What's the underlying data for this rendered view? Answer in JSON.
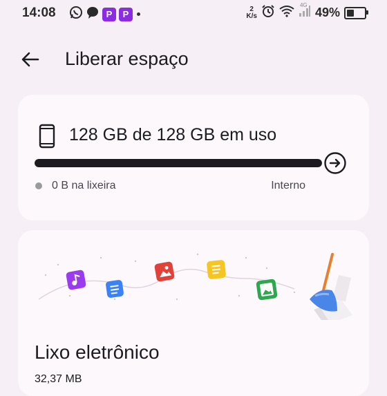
{
  "status_bar": {
    "time": "14:08",
    "app_badge_letter": "P",
    "net_speed_value": "2",
    "net_speed_unit": "K/s",
    "network_type": "4G",
    "battery_percent": "49%",
    "battery_level": 0.49
  },
  "header": {
    "title": "Liberar espaço"
  },
  "storage_card": {
    "usage_text": "128 GB de 128 GB em uso",
    "usage_fraction": 1.0,
    "trash_text": "0 B na lixeira",
    "location_text": "Interno"
  },
  "junk_card": {
    "title": "Lixo eletrônico",
    "size": "32,37 MB"
  },
  "colors": {
    "background": "#f6eff6",
    "card": "#fdf8fc",
    "progress_fill": "#1c1b1f",
    "icon_purple": "#9b3bf0",
    "icon_blue": "#3b82f6",
    "icon_red": "#e0423a",
    "icon_yellow": "#f7c521",
    "icon_green": "#2ea84f",
    "broom_blue": "#4a86e8"
  },
  "icons": [
    "whatsapp-icon",
    "chat-bubble-icon",
    "app-badge-icon",
    "alarm-icon",
    "wifi-icon",
    "signal-icon",
    "battery-icon",
    "back-arrow-icon",
    "phone-icon",
    "arrow-right-circle-icon",
    "broom-icon"
  ]
}
